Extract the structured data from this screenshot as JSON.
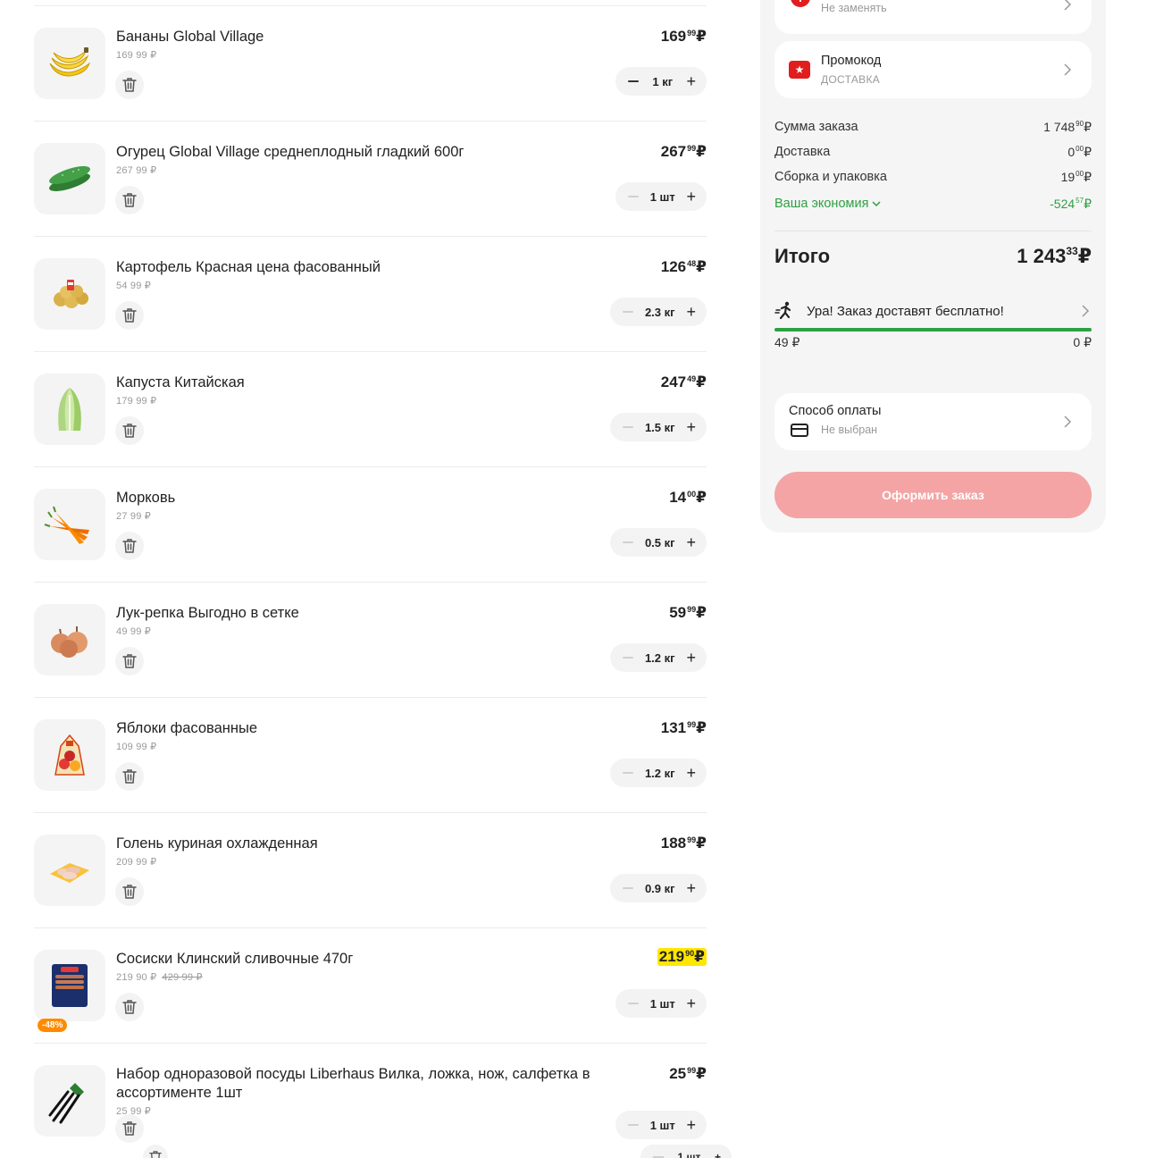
{
  "cart": {
    "items": [
      {
        "name": "Бананы Global Village",
        "unit_price": "169 99 ₽",
        "old_price": "",
        "price_main": "169",
        "price_kop": "99",
        "currency": "₽",
        "qty": "1 кг",
        "minus_active": true,
        "promo": false,
        "discount": ""
      },
      {
        "name": "Огурец Global Village среднеплодный гладкий 600г",
        "unit_price": "267 99 ₽",
        "old_price": "",
        "price_main": "267",
        "price_kop": "99",
        "currency": "₽",
        "qty": "1 шт",
        "minus_active": false,
        "promo": false,
        "discount": ""
      },
      {
        "name": "Картофель Красная цена фасованный",
        "unit_price": "54 99 ₽",
        "old_price": "",
        "price_main": "126",
        "price_kop": "48",
        "currency": "₽",
        "qty": "2.3 кг",
        "minus_active": false,
        "promo": false,
        "discount": ""
      },
      {
        "name": "Капуста Китайская",
        "unit_price": "179 99 ₽",
        "old_price": "",
        "price_main": "247",
        "price_kop": "49",
        "currency": "₽",
        "qty": "1.5 кг",
        "minus_active": false,
        "promo": false,
        "discount": ""
      },
      {
        "name": "Морковь",
        "unit_price": "27 99 ₽",
        "old_price": "",
        "price_main": "14",
        "price_kop": "00",
        "currency": "₽",
        "qty": "0.5 кг",
        "minus_active": false,
        "promo": false,
        "discount": ""
      },
      {
        "name": "Лук-репка Выгодно в сетке",
        "unit_price": "49 99 ₽",
        "old_price": "",
        "price_main": "59",
        "price_kop": "99",
        "currency": "₽",
        "qty": "1.2 кг",
        "minus_active": false,
        "promo": false,
        "discount": ""
      },
      {
        "name": "Яблоки фасованные",
        "unit_price": "109 99 ₽",
        "old_price": "",
        "price_main": "131",
        "price_kop": "99",
        "currency": "₽",
        "qty": "1.2 кг",
        "minus_active": false,
        "promo": false,
        "discount": ""
      },
      {
        "name": "Голень куриная охлажденная",
        "unit_price": "209 99 ₽",
        "old_price": "",
        "price_main": "188",
        "price_kop": "99",
        "currency": "₽",
        "qty": "0.9 кг",
        "minus_active": false,
        "promo": false,
        "discount": ""
      },
      {
        "name": "Сосиски Клинский сливочные 470г",
        "unit_price": "219 90 ₽",
        "old_price": "429 99 ₽",
        "price_main": "219",
        "price_kop": "90",
        "currency": "₽",
        "qty": "1 шт",
        "minus_active": false,
        "promo": true,
        "discount": "-48%"
      },
      {
        "name": "Набор одноразовой посуды Liberhaus Вилка, ложка, нож, салфетка в ассортименте 1шт",
        "unit_price": "25 99 ₽",
        "old_price": "",
        "price_main": "25",
        "price_kop": "99",
        "currency": "₽",
        "qty": "1 шт",
        "minus_active": false,
        "promo": false,
        "discount": ""
      }
    ],
    "ghost_qty": "1 шт"
  },
  "summary": {
    "replace_sub": "Не заменять",
    "promo_title": "Промокод",
    "promo_sub": "ДОСТАВКА",
    "order_sum_label": "Сумма заказа",
    "order_sum_main": "1 748",
    "order_sum_kop": "90",
    "delivery_label": "Доставка",
    "delivery_main": "0",
    "delivery_kop": "00",
    "packing_label": "Сборка и упаковка",
    "packing_main": "19",
    "packing_kop": "00",
    "savings_label": "Ваша экономия",
    "savings_main": "-524",
    "savings_kop": "57",
    "currency": "₽",
    "total_label": "Итого",
    "total_main": "1 243",
    "total_kop": "33",
    "free_delivery_text": "Ура! Заказ доставят бесплатно!",
    "progress_fraction": 1.0,
    "progress_left": "49 ₽",
    "progress_right": "0 ₽",
    "payment_title": "Способ оплаты",
    "payment_sub": "Не выбран",
    "checkout_label": "Оформить заказ"
  },
  "colors": {
    "accent_green": "#2ea043",
    "brand_red": "#e11d1d",
    "cta_disabled": "#f4a4a4",
    "promo_yellow": "#ffe600",
    "discount_orange": "#ff8a00"
  },
  "icons": [
    "banana-icon",
    "cucumber-icon",
    "potato-bag-icon",
    "cabbage-icon",
    "carrot-icon",
    "onion-icon",
    "apple-bag-icon",
    "chicken-tray-icon",
    "sausage-pack-icon",
    "cutlery-set-icon",
    "trash-icon",
    "minus-icon",
    "plus-icon",
    "chevron-right-icon",
    "chevron-down-icon",
    "alert-icon",
    "ticket-icon",
    "runner-icon",
    "card-icon"
  ]
}
